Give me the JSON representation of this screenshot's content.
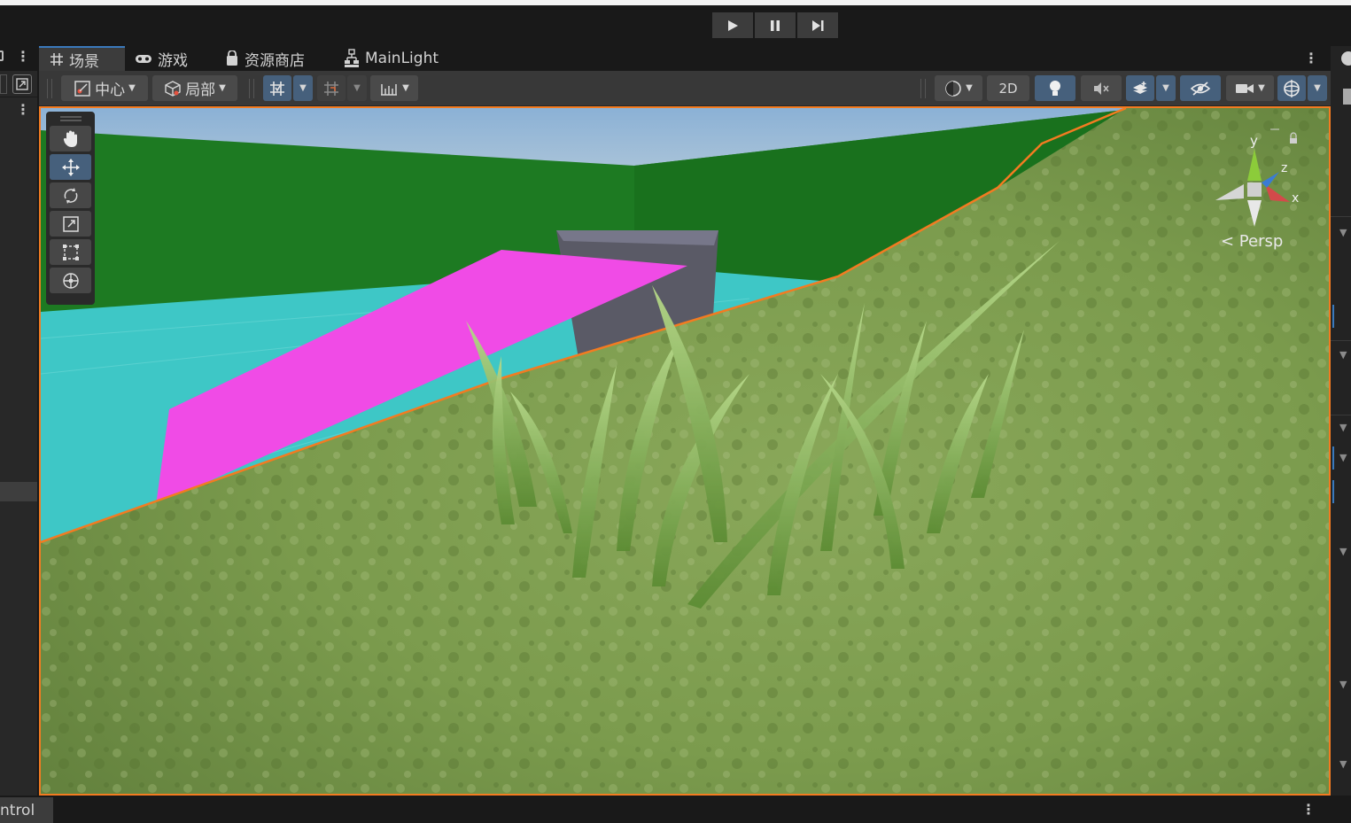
{
  "play_controls": {
    "play_icon": "play-icon",
    "pause_icon": "pause-icon",
    "step_icon": "step-icon"
  },
  "tabs": [
    {
      "label": "场景",
      "icon": "scene-grid-icon",
      "active": true
    },
    {
      "label": "游戏",
      "icon": "gamepad-icon",
      "active": false
    },
    {
      "label": "资源商店",
      "icon": "shopping-bag-icon",
      "active": false
    },
    {
      "label": "MainLight",
      "icon": "hierarchy-icon",
      "active": false
    }
  ],
  "toolbar": {
    "pivot_label": "中心",
    "space_label": "局部",
    "mode_2d_label": "2D"
  },
  "viewport": {
    "projection_label": "< Persp",
    "axis_y": "y",
    "axis_z": "z",
    "axis_x": "x"
  },
  "bottom": {
    "tab_label": "ntrol"
  },
  "colors": {
    "accent_blue": "#46607c",
    "selection_orange": "#f37b21",
    "panel_dark": "#191919",
    "toolbar": "#383838"
  }
}
